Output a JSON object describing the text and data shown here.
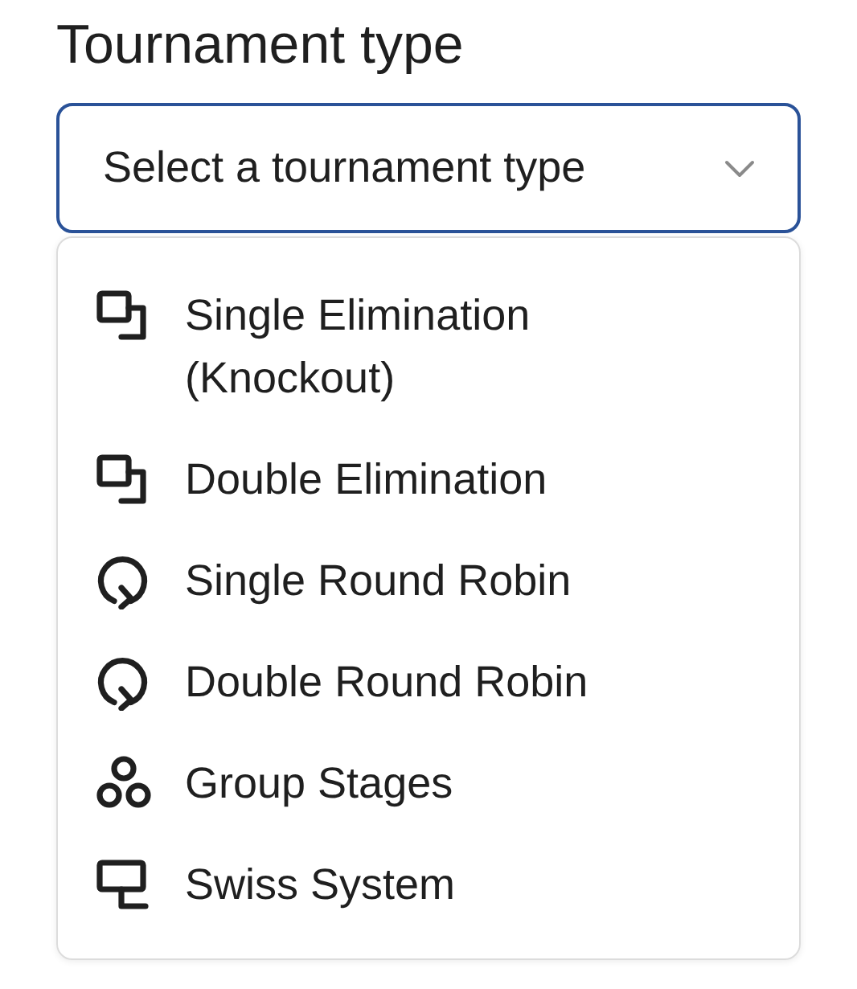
{
  "heading": "Tournament type",
  "select": {
    "placeholder": "Select a tournament type",
    "expanded": true
  },
  "options": [
    {
      "label": "Single Elimination (Knockout)",
      "kind": "bracket"
    },
    {
      "label": "Double Elimination",
      "kind": "bracket"
    },
    {
      "label": "Single Round Robin",
      "kind": "cycle"
    },
    {
      "label": "Double Round Robin",
      "kind": "cycle"
    },
    {
      "label": "Group Stages",
      "kind": "groups"
    },
    {
      "label": "Swiss System",
      "kind": "swiss"
    }
  ]
}
